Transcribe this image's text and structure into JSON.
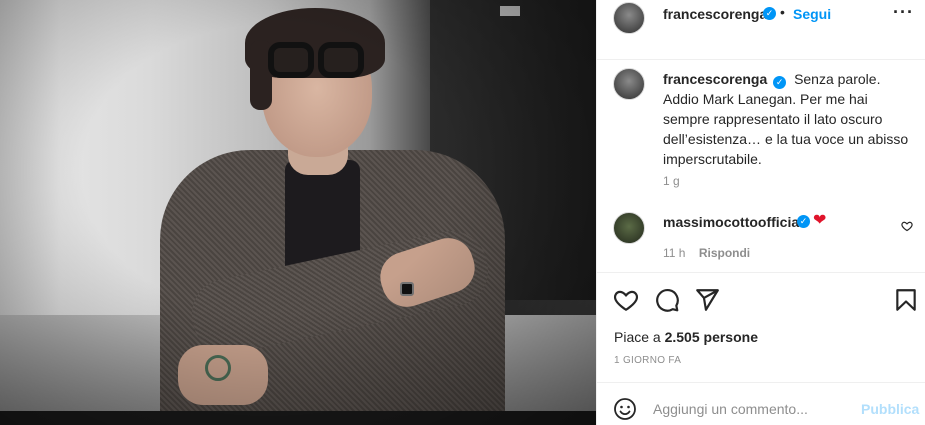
{
  "post": {
    "author": "francescorenga",
    "verified_mark": "✓",
    "separator": "•",
    "follow_label": "Segui",
    "more_label": "···"
  },
  "caption": {
    "author": "francescorenga",
    "text": "Senza parole. Addio Mark Lanegan. Per me hai sempre rappresentato il lato oscuro dell’esistenza… e la tua voce un abisso imperscrutabile.",
    "time": "1 g"
  },
  "comment": {
    "author": "massimocottoofficial",
    "text": "❤",
    "time": "11 h",
    "reply_label": "Rispondi"
  },
  "likes": {
    "prefix": "Piace a ",
    "count": "2.505 persone"
  },
  "date": "1 GIORNO FA",
  "compose": {
    "placeholder": "Aggiungi un commento...",
    "publish_label": "Pubblica"
  },
  "icons": {
    "like": "heart-icon",
    "comment": "comment-icon",
    "share": "share-icon",
    "save": "bookmark-icon",
    "emoji": "emoji-icon"
  },
  "colors": {
    "accent": "#0095f6",
    "publish_disabled": "#b2dffc",
    "heart": "#e0142b"
  }
}
